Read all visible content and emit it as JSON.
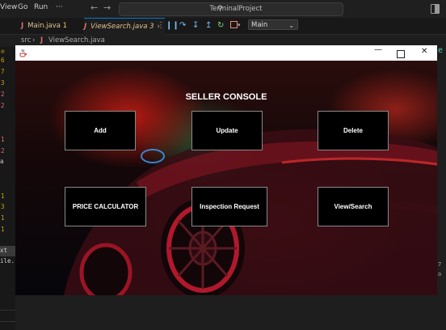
{
  "menubar": {
    "items": [
      "View",
      "Go",
      "Run",
      "···"
    ],
    "title": "TerminalProject"
  },
  "tabs": [
    {
      "label": "Main.java 1"
    },
    {
      "label": "ViewSearch.java 3"
    }
  ],
  "debug": {
    "config": "Main"
  },
  "breadcrumb": {
    "folder": "src",
    "file": "ViewSearch.java"
  },
  "gutter": {
    "numbers": [
      "6",
      "7",
      "3",
      "2",
      "2",
      "1",
      "2",
      "1",
      "3",
      "1",
      "1"
    ],
    "texts": [
      "a",
      "xt",
      "ile..."
    ]
  },
  "app_window": {
    "title": "",
    "console_title": "SELLER CONSOLE",
    "buttons": {
      "add": "Add",
      "update": "Update",
      "delete": "Delete",
      "price_calculator": "PRICE CALCULATOR",
      "inspection_request": "Inspection Request",
      "view_search": "View/Search"
    }
  },
  "colors": {
    "editor_bg": "#1e1e1e",
    "accent": "#0078d4",
    "warning": "#cca700",
    "error": "#e06c6c"
  }
}
